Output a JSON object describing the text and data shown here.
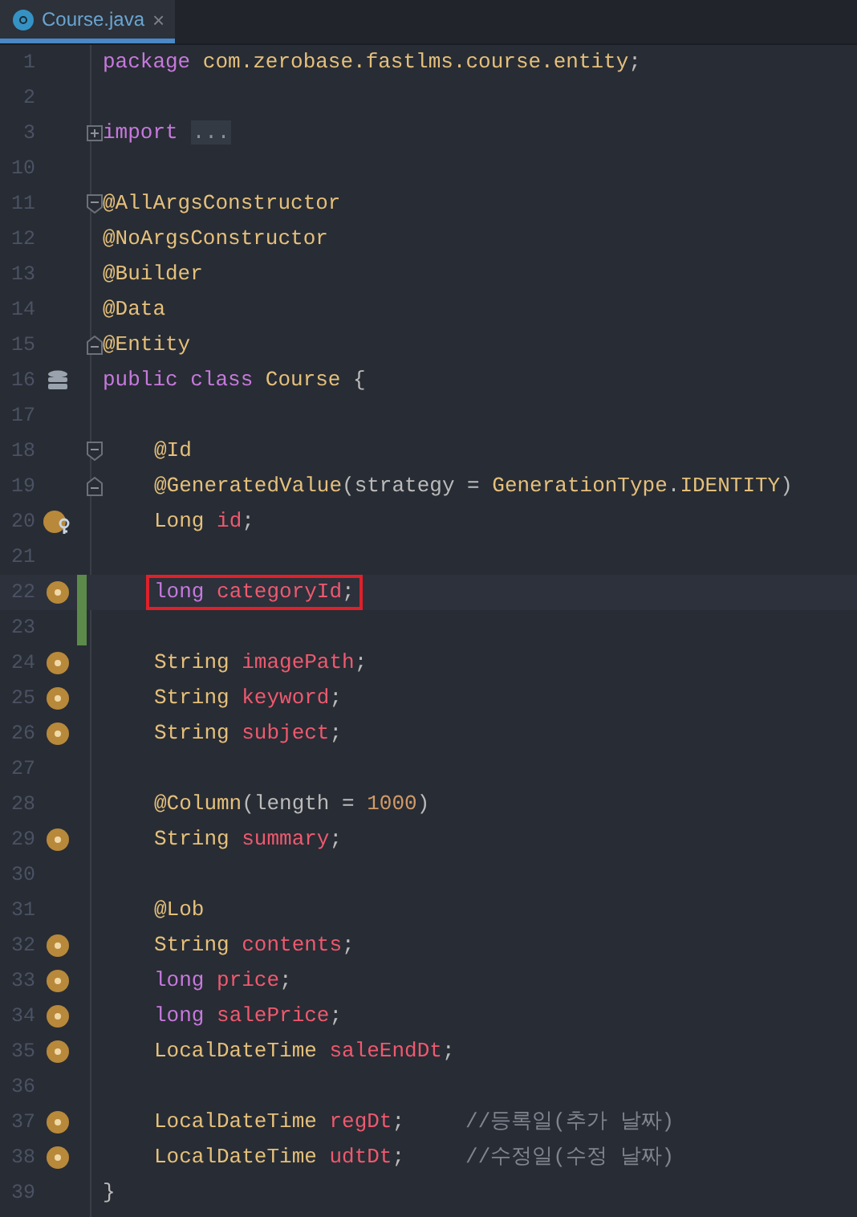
{
  "tab": {
    "title": "Course.java",
    "close": "×",
    "selected": true
  },
  "lines": [
    {
      "number": "1",
      "tokens": [
        {
          "text": "package",
          "kind": "keyword"
        },
        {
          "text": " com.zerobase.fastlms.course.entity",
          "kind": "type"
        },
        {
          "text": ";",
          "kind": "plain"
        }
      ]
    },
    {
      "number": "2"
    },
    {
      "number": "3",
      "fold": {
        "kind": "collapsed"
      },
      "tokens": [
        {
          "text": "import",
          "kind": "keyword"
        },
        {
          "text": "...",
          "kind": "folded"
        }
      ]
    },
    {
      "number": "10"
    },
    {
      "number": "11",
      "fold": {
        "kind": "start"
      },
      "tokens": [
        {
          "text": "@AllArgsConstructor",
          "kind": "annotation"
        }
      ]
    },
    {
      "number": "12",
      "tokens": [
        {
          "text": "@NoArgsConstructor",
          "kind": "annotation"
        }
      ]
    },
    {
      "number": "13",
      "tokens": [
        {
          "text": "@Builder",
          "kind": "annotation"
        }
      ]
    },
    {
      "number": "14",
      "tokens": [
        {
          "text": "@Data",
          "kind": "annotation"
        }
      ]
    },
    {
      "number": "15",
      "fold": {
        "kind": "end"
      },
      "tokens": [
        {
          "text": "@Entity",
          "kind": "annotation"
        }
      ]
    },
    {
      "number": "16",
      "gutter": {
        "kind": "table"
      },
      "tokens": [
        {
          "text": "public class",
          "kind": "keyword"
        },
        {
          "text": " Course ",
          "kind": "type"
        },
        {
          "text": "{",
          "kind": "plain"
        }
      ]
    },
    {
      "number": "17"
    },
    {
      "number": "18",
      "indented": true,
      "fold": {
        "kind": "start"
      },
      "tokens": [
        {
          "text": "@Id",
          "kind": "annotation"
        }
      ]
    },
    {
      "number": "19",
      "indented": true,
      "fold": {
        "kind": "end"
      },
      "tokens": [
        {
          "text": "@GeneratedValue",
          "kind": "annotation"
        },
        {
          "text": "(strategy = ",
          "kind": "plain"
        },
        {
          "text": "GenerationType",
          "kind": "type"
        },
        {
          "text": ".",
          "kind": "plain"
        },
        {
          "text": "IDENTITY",
          "kind": "constant"
        },
        {
          "text": ")",
          "kind": "plain"
        }
      ]
    },
    {
      "number": "20",
      "indented": true,
      "gutter": {
        "kind": "key"
      },
      "tokens": [
        {
          "text": "Long ",
          "kind": "type"
        },
        {
          "text": "id",
          "kind": "field"
        },
        {
          "text": ";",
          "kind": "plain"
        }
      ]
    },
    {
      "number": "21"
    },
    {
      "number": "22",
      "indented": true,
      "gutter": {
        "kind": "field"
      },
      "changed": true,
      "current": true,
      "boxed": true,
      "tokens": [
        {
          "text": "long ",
          "kind": "keyword"
        },
        {
          "text": "categoryId",
          "kind": "field"
        },
        {
          "text": ";",
          "kind": "plain"
        }
      ]
    },
    {
      "number": "23",
      "changed": true
    },
    {
      "number": "24",
      "indented": true,
      "gutter": {
        "kind": "field"
      },
      "tokens": [
        {
          "text": "String ",
          "kind": "type"
        },
        {
          "text": "imagePath",
          "kind": "field"
        },
        {
          "text": ";",
          "kind": "plain"
        }
      ]
    },
    {
      "number": "25",
      "indented": true,
      "gutter": {
        "kind": "field"
      },
      "tokens": [
        {
          "text": "String ",
          "kind": "type"
        },
        {
          "text": "keyword",
          "kind": "field"
        },
        {
          "text": ";",
          "kind": "plain"
        }
      ]
    },
    {
      "number": "26",
      "indented": true,
      "gutter": {
        "kind": "field"
      },
      "tokens": [
        {
          "text": "String ",
          "kind": "type"
        },
        {
          "text": "subject",
          "kind": "field"
        },
        {
          "text": ";",
          "kind": "plain"
        }
      ]
    },
    {
      "number": "27"
    },
    {
      "number": "28",
      "indented": true,
      "tokens": [
        {
          "text": "@Column",
          "kind": "annotation"
        },
        {
          "text": "(length = ",
          "kind": "plain"
        },
        {
          "text": "1000",
          "kind": "number"
        },
        {
          "text": ")",
          "kind": "plain"
        }
      ]
    },
    {
      "number": "29",
      "indented": true,
      "gutter": {
        "kind": "field"
      },
      "tokens": [
        {
          "text": "String ",
          "kind": "type"
        },
        {
          "text": "summary",
          "kind": "field"
        },
        {
          "text": ";",
          "kind": "plain"
        }
      ]
    },
    {
      "number": "30"
    },
    {
      "number": "31",
      "indented": true,
      "tokens": [
        {
          "text": "@Lob",
          "kind": "annotation"
        }
      ]
    },
    {
      "number": "32",
      "indented": true,
      "gutter": {
        "kind": "field"
      },
      "tokens": [
        {
          "text": "String ",
          "kind": "type"
        },
        {
          "text": "contents",
          "kind": "field"
        },
        {
          "text": ";",
          "kind": "plain"
        }
      ]
    },
    {
      "number": "33",
      "indented": true,
      "gutter": {
        "kind": "field"
      },
      "tokens": [
        {
          "text": "long ",
          "kind": "keyword"
        },
        {
          "text": "price",
          "kind": "field"
        },
        {
          "text": ";",
          "kind": "plain"
        }
      ]
    },
    {
      "number": "34",
      "indented": true,
      "gutter": {
        "kind": "field"
      },
      "tokens": [
        {
          "text": "long ",
          "kind": "keyword"
        },
        {
          "text": "salePrice",
          "kind": "field"
        },
        {
          "text": ";",
          "kind": "plain"
        }
      ]
    },
    {
      "number": "35",
      "indented": true,
      "gutter": {
        "kind": "field"
      },
      "tokens": [
        {
          "text": "LocalDateTime ",
          "kind": "type"
        },
        {
          "text": "saleEndDt",
          "kind": "field"
        },
        {
          "text": ";",
          "kind": "plain"
        }
      ]
    },
    {
      "number": "36"
    },
    {
      "number": "37",
      "indented": true,
      "gutter": {
        "kind": "field"
      },
      "tokens": [
        {
          "text": "LocalDateTime ",
          "kind": "type"
        },
        {
          "text": "regDt",
          "kind": "field"
        },
        {
          "text": ";",
          "kind": "plain"
        },
        {
          "text": "//등록일(추가 날짜)",
          "kind": "comment"
        }
      ]
    },
    {
      "number": "38",
      "indented": true,
      "gutter": {
        "kind": "field"
      },
      "tokens": [
        {
          "text": "LocalDateTime ",
          "kind": "type"
        },
        {
          "text": "udtDt",
          "kind": "field"
        },
        {
          "text": ";",
          "kind": "plain"
        },
        {
          "text": "//수정일(수정 날짜)",
          "kind": "comment"
        }
      ]
    },
    {
      "number": "39",
      "tokens": [
        {
          "text": "}",
          "kind": "plain"
        }
      ]
    }
  ]
}
